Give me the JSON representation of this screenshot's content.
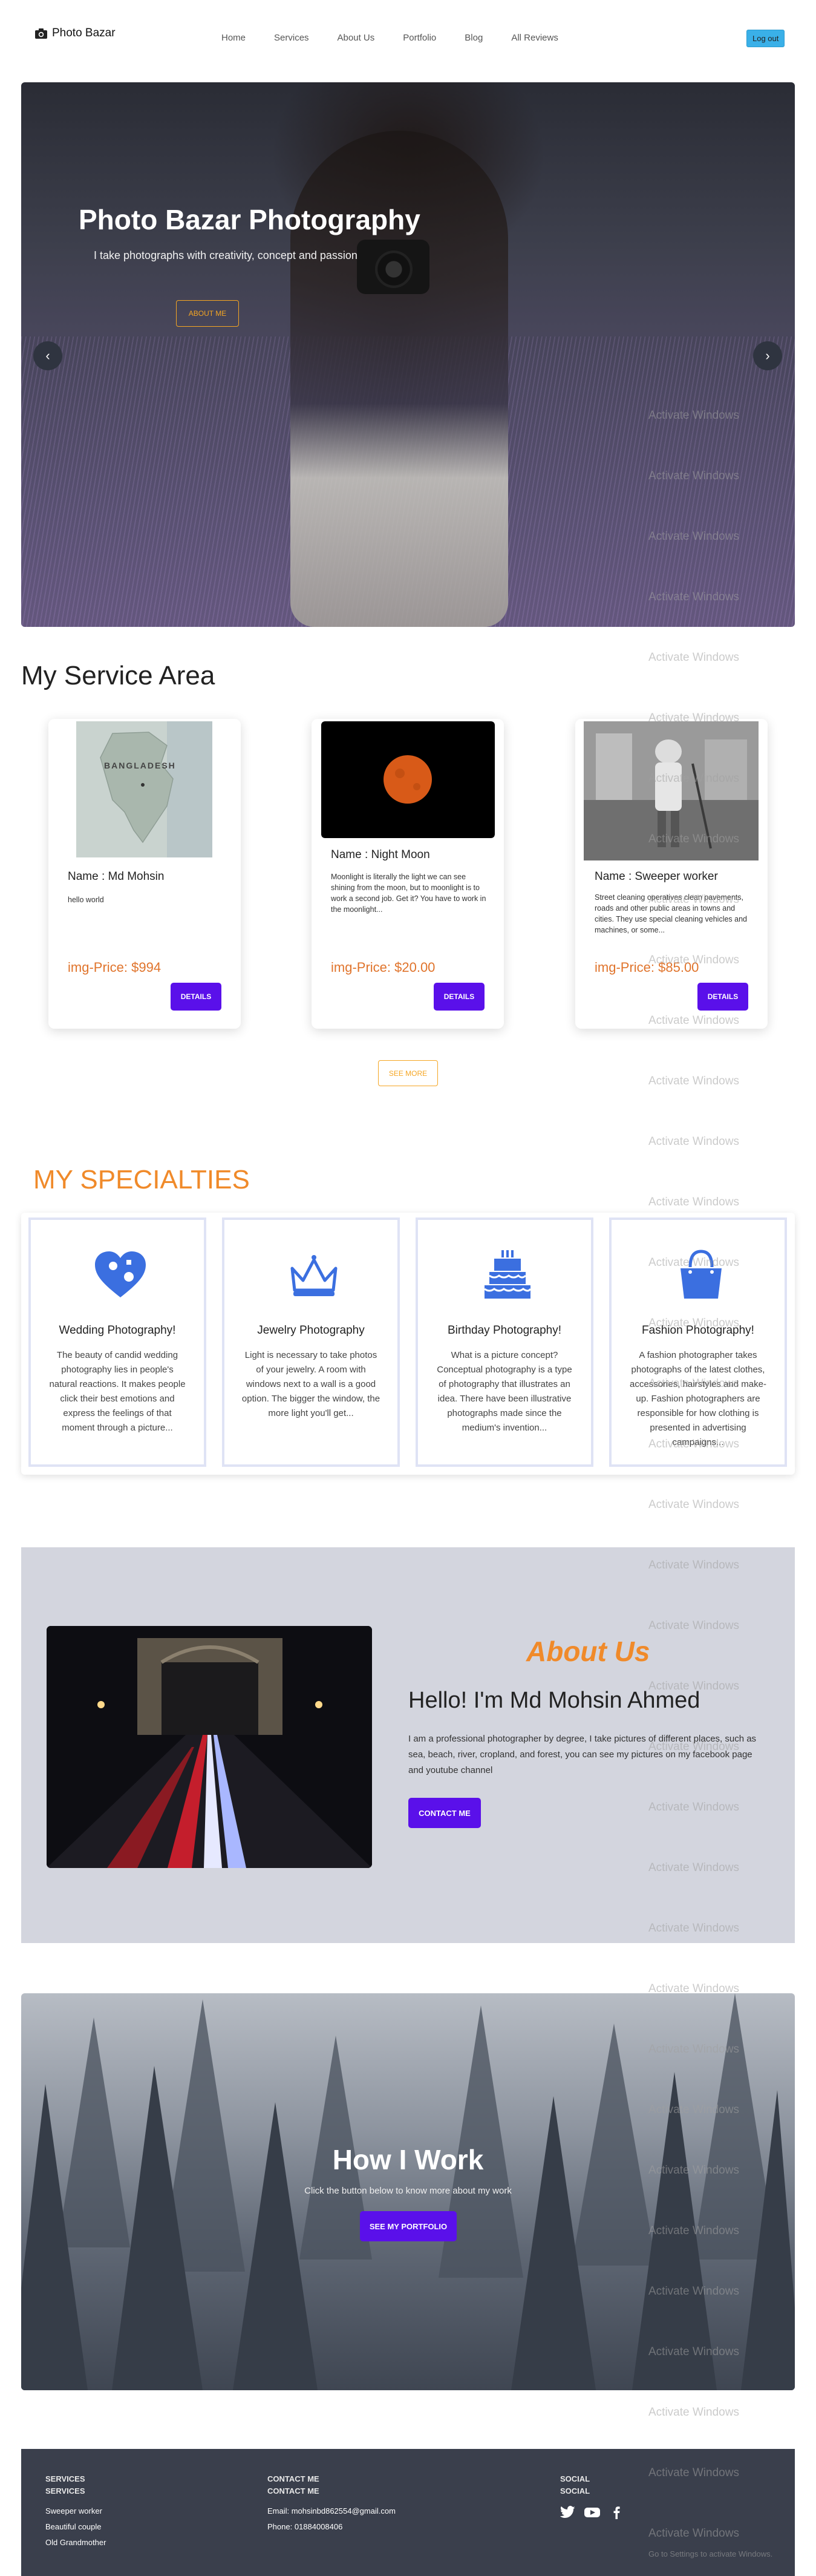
{
  "nav": {
    "brand": "Photo Bazar",
    "items": [
      "Home",
      "Services",
      "About Us",
      "Portfolio",
      "Blog",
      "All Reviews"
    ],
    "logout": "Log out"
  },
  "hero": {
    "title": "Photo Bazar Photography",
    "subtitle": "I take photographs with creativity, concept and passion",
    "button": "ABOUT ME",
    "prev_icon": "chevron-left-icon",
    "next_icon": "chevron-right-icon"
  },
  "services": {
    "title": "My Service Area",
    "cards": [
      {
        "name": "Name : Md Mohsin",
        "desc": "hello world",
        "price": "img-Price: $994",
        "button": "DETAILS"
      },
      {
        "name": "Name : Night Moon",
        "desc": "Moonlight is literally the light we can see shining from the moon, but to moonlight is to work a second job. Get it? You have to work in the moonlight...",
        "price": "img-Price: $20.00",
        "button": "DETAILS"
      },
      {
        "name": "Name : Sweeper worker",
        "desc": "Street cleaning operatives clean pavements, roads and other public areas in towns and cities. They use special cleaning vehicles and machines, or some...",
        "price": "img-Price: $85.00",
        "button": "DETAILS"
      }
    ],
    "see_more": "SEE MORE"
  },
  "specialties": {
    "title": "MY SPECIALTIES",
    "items": [
      {
        "title": "Wedding Photography!",
        "desc": "The beauty of candid wedding photography lies in people's natural reactions. It makes people click their best emotions and express the feelings of that moment through a picture...",
        "icon": "heart-puzzle-icon"
      },
      {
        "title": "Jewelry Photography",
        "desc": "Light is necessary to take photos of your jewelry. A room with windows next to a wall is a good option. The bigger the window, the more light you'll get...",
        "icon": "crown-icon"
      },
      {
        "title": "Birthday Photography!",
        "desc": "What is a picture concept? Conceptual photography is a type of photography that illustrates an idea. There have been illustrative photographs made since the medium's invention...",
        "icon": "birthday-cake-icon"
      },
      {
        "title": "Fashion Photography!",
        "desc": "A fashion photographer takes photographs of the latest clothes, accessories, hairstyles and make-up. Fashion photographers are responsible for how clothing is presented in advertising campaigns...",
        "icon": "shopping-bag-icon"
      }
    ]
  },
  "about": {
    "title": "About Us",
    "heading": "Hello! I'm Md Mohsin Ahmed",
    "text": "I am a professional photographer by degree, I take pictures of different places, such as sea, beach, river, cropland, and forest, you can see my pictures on my facebook page and youtube channel",
    "button": "CONTACT ME"
  },
  "how": {
    "title": "How I Work",
    "subtitle": "Click the button below to know more about my work",
    "button": "SEE MY PORTFOLIO"
  },
  "footer": {
    "services": {
      "h1": "SERVICES",
      "h2": "SERVICES",
      "items": [
        "Sweeper worker",
        "Beautiful couple",
        "Old Grandmother"
      ]
    },
    "contact": {
      "h1": "CONTACT ME",
      "h2": "CONTACT ME",
      "email": "Email: mohsinbd862554@gmail.com",
      "phone": "Phone: 01884008406"
    },
    "social": {
      "h1": "SOCIAL",
      "h2": "SOCIAL",
      "icons": [
        "twitter-icon",
        "youtube-icon",
        "facebook-icon"
      ]
    }
  },
  "watermark": {
    "text": "Activate Windows",
    "settings": "Go to Settings to activate Windows."
  },
  "colors": {
    "accent_orange": "#f08a2a",
    "primary_purple": "#5a10ea",
    "logout_blue": "#3ab0e8",
    "icon_blue": "#3b6fe0"
  }
}
